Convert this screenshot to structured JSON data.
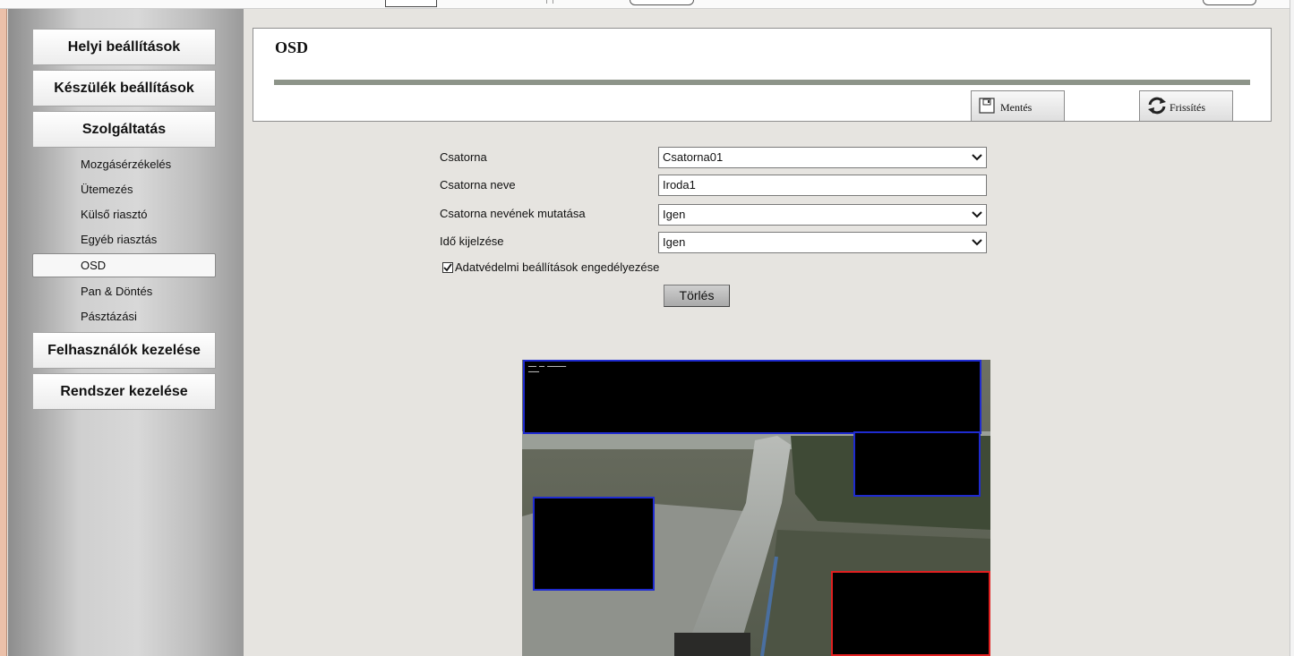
{
  "sidebar": {
    "local_settings": "Helyi beállítások",
    "device_settings": "Készülék beállítások",
    "service": "Szolgáltatás",
    "sub_items": [
      "Mozgásérzékelés",
      "Ütemezés",
      "Külső riasztó",
      "Egyéb riasztás",
      "OSD",
      "Pan & Döntés",
      "Pásztázási"
    ],
    "user_management": "Felhasználók kezelése",
    "system_management": "Rendszer kezelése"
  },
  "header": {
    "title": "OSD",
    "save_label": "Mentés",
    "refresh_label": "Frissítés"
  },
  "form": {
    "channel_label": "Csatorna",
    "channel_value": "Csatorna01",
    "channel_name_label": "Csatorna neve",
    "channel_name_value": "Iroda1",
    "show_name_label": "Csatorna nevének mutatása",
    "show_name_value": "Igen",
    "show_time_label": "Idő kijelzése",
    "show_time_value": "Igen",
    "privacy_label": "Adatvédelmi beállítások engedélyezése",
    "privacy_checked": true,
    "clear_label": "Törlés"
  },
  "icons": {
    "save": "floppy-disk-icon",
    "refresh": "refresh-arrows-icon",
    "dropdown": "chevron-down-icon",
    "checkbox": "check-icon"
  },
  "colors": {
    "privacy_mask_border": "#1f2bd0",
    "selected_mask_border": "#e02020",
    "header_bar": "#8d9489"
  }
}
